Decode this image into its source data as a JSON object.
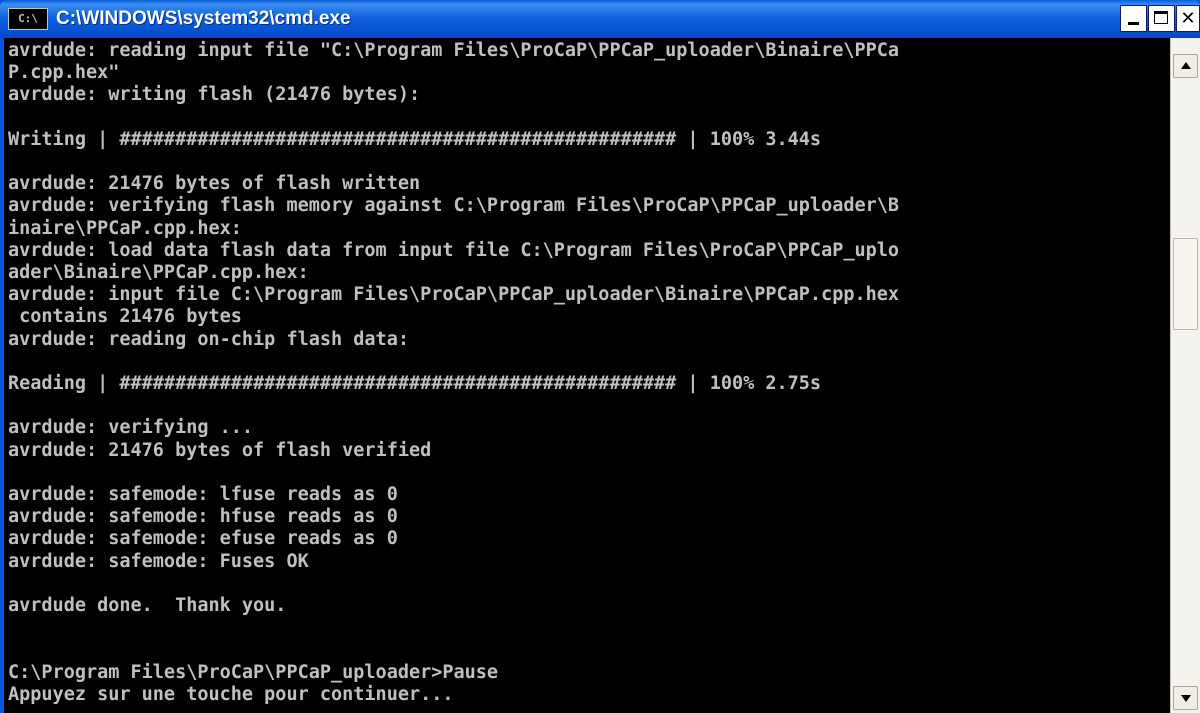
{
  "window": {
    "title": "C:\\WINDOWS\\system32\\cmd.exe",
    "icon_label": "C:\\"
  },
  "controls": {
    "minimize": "minimize-icon",
    "maximize": "maximize-icon",
    "close": "✕"
  },
  "console": {
    "lines": [
      "avrdude: reading input file \"C:\\Program Files\\ProCaP\\PPCaP_uploader\\Binaire\\PPCa",
      "P.cpp.hex\"",
      "avrdude: writing flash (21476 bytes):",
      "",
      "Writing | ################################################## | 100% 3.44s",
      "",
      "avrdude: 21476 bytes of flash written",
      "avrdude: verifying flash memory against C:\\Program Files\\ProCaP\\PPCaP_uploader\\B",
      "inaire\\PPCaP.cpp.hex:",
      "avrdude: load data flash data from input file C:\\Program Files\\ProCaP\\PPCaP_uplo",
      "ader\\Binaire\\PPCaP.cpp.hex:",
      "avrdude: input file C:\\Program Files\\ProCaP\\PPCaP_uploader\\Binaire\\PPCaP.cpp.hex",
      " contains 21476 bytes",
      "avrdude: reading on-chip flash data:",
      "",
      "Reading | ################################################## | 100% 2.75s",
      "",
      "avrdude: verifying ...",
      "avrdude: 21476 bytes of flash verified",
      "",
      "avrdude: safemode: lfuse reads as 0",
      "avrdude: safemode: hfuse reads as 0",
      "avrdude: safemode: efuse reads as 0",
      "avrdude: safemode: Fuses OK",
      "",
      "avrdude done.  Thank you.",
      "",
      "",
      "C:\\Program Files\\ProCaP\\PPCaP_uploader>Pause",
      "Appuyez sur une touche pour continuer..."
    ]
  },
  "colors": {
    "console_bg": "#000000",
    "console_fg": "#c0c0c0",
    "titlebar": "#0553d3"
  }
}
